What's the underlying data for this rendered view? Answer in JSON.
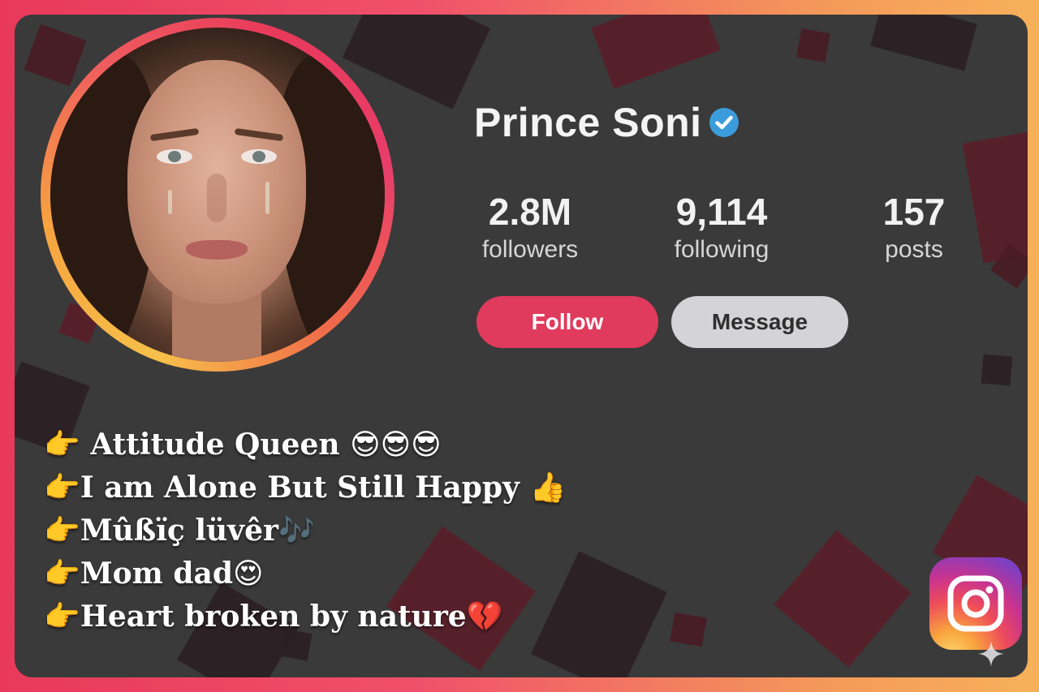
{
  "profile": {
    "name": "Prince Soni",
    "verified": true,
    "stats": [
      {
        "value": "2.8M",
        "label": "followers"
      },
      {
        "value": "9,114",
        "label": "following"
      },
      {
        "value": "157",
        "label": "posts"
      }
    ],
    "buttons": {
      "follow": "Follow",
      "message": "Message"
    }
  },
  "bio": [
    {
      "pointer": "👉",
      "text": " Attitude Queen ",
      "emoji": "😎😎😎"
    },
    {
      "pointer": "👉",
      "text": "I am Alone But Still Happy ",
      "emoji": "👍"
    },
    {
      "pointer": "👉",
      "text": "Mûßïç lüvêr",
      "emoji": "🎶"
    },
    {
      "pointer": "👉",
      "text": "Mom dad",
      "emoji": "😍"
    },
    {
      "pointer": "👉",
      "text": "Heart broken by nature",
      "emoji": "💔"
    }
  ],
  "colors": {
    "follow_button": "#e03a5c",
    "message_button": "#d4d4d6",
    "card_background": "#3a3a3b",
    "verified_badge": "#3b9cdc",
    "frame_gradient_start": "#e8395a",
    "frame_gradient_end": "#f7b15a"
  },
  "icons": {
    "verified": "verified-check-icon",
    "brand": "instagram-icon",
    "corner": "sparkle-icon"
  }
}
